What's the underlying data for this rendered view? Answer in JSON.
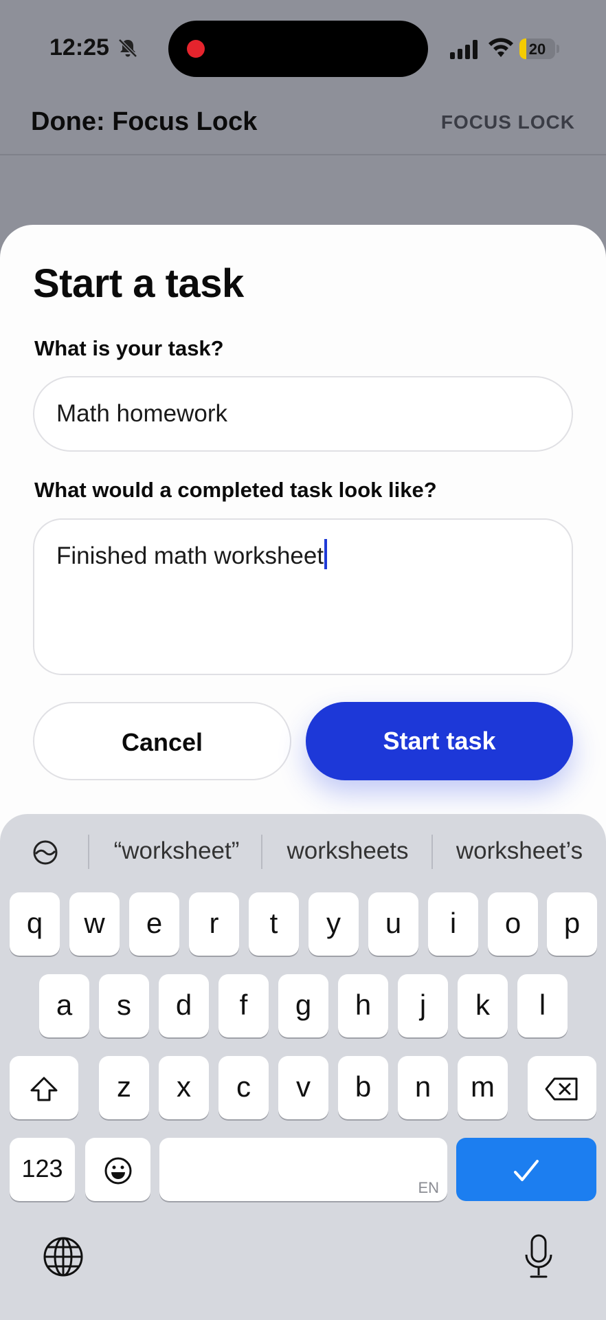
{
  "status": {
    "time": "12:25",
    "battery": "20",
    "battery_level": 0.2,
    "icons": [
      "bell-slash-icon",
      "recording-dot-icon",
      "cellular-signal-icon",
      "wifi-icon",
      "battery-icon"
    ]
  },
  "header": {
    "title": "Done: Focus Lock",
    "brand": "FOCUS LOCK"
  },
  "sheet": {
    "title": "Start a task",
    "task_label": "What is your task?",
    "task_value": "Math homework",
    "done_label": "What would a completed task look like?",
    "done_value": "Finished math worksheet",
    "cancel_label": "Cancel",
    "start_label": "Start task"
  },
  "keyboard": {
    "suggestions": [
      "“worksheet”",
      "worksheets",
      "worksheet’s"
    ],
    "row1": [
      "q",
      "w",
      "e",
      "r",
      "t",
      "y",
      "u",
      "i",
      "o",
      "p"
    ],
    "row2": [
      "a",
      "s",
      "d",
      "f",
      "g",
      "h",
      "j",
      "k",
      "l"
    ],
    "row3": [
      "z",
      "x",
      "c",
      "v",
      "b",
      "n",
      "m"
    ],
    "numbers_key": "123",
    "space_lang": "EN",
    "colors": {
      "return_key": "#1c7ef0",
      "start_button": "#1d38d8"
    }
  }
}
